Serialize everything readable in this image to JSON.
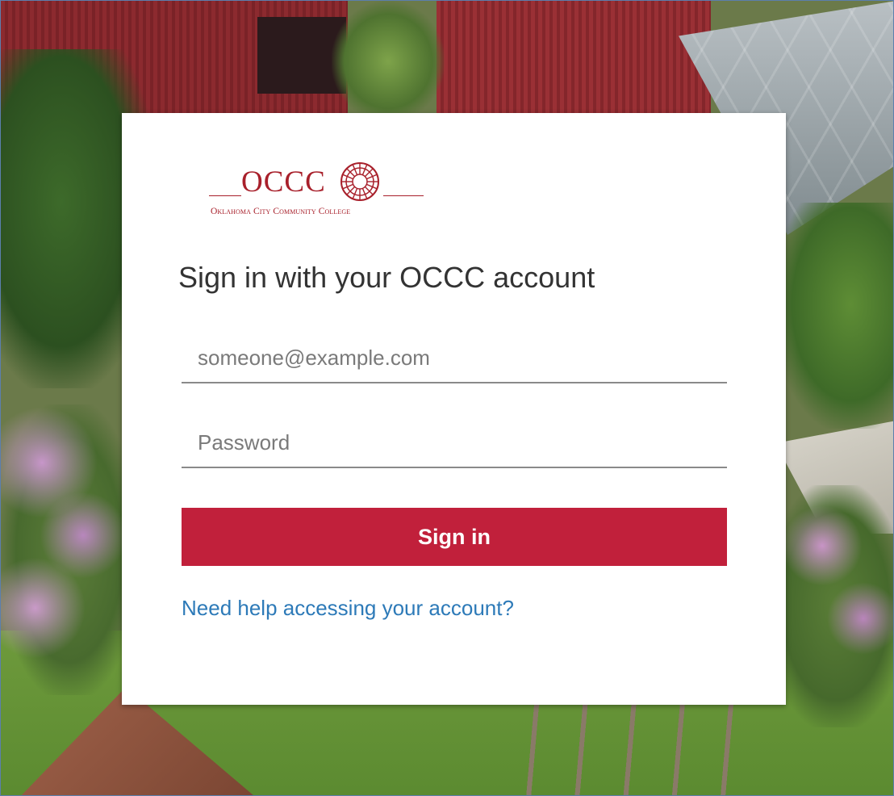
{
  "logo": {
    "name": "OCCC",
    "full_name": "Oklahoma City Community College",
    "brand_color": "#a8202b"
  },
  "login": {
    "heading": "Sign in with your OCCC account",
    "email_placeholder": "someone@example.com",
    "email_value": "",
    "password_placeholder": "Password",
    "password_value": "",
    "signin_label": "Sign in",
    "help_link": "Need help accessing your account?"
  },
  "colors": {
    "button": "#c1203b",
    "link": "#2d7ab8",
    "heading": "#333333"
  }
}
